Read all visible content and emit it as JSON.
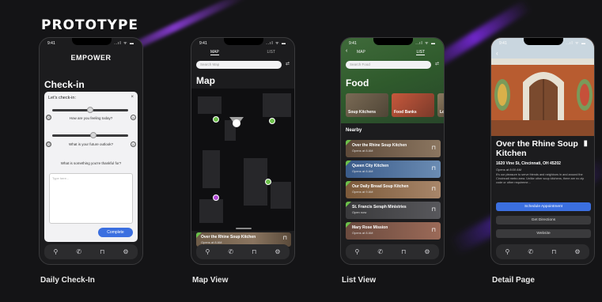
{
  "title": "PROTOTYPE",
  "labels": {
    "checkin": "Daily Check-In",
    "map": "Map View",
    "list": "List View",
    "detail": "Detail Page"
  },
  "status": {
    "time": "9:41",
    "signal": "..ıl ᯤ ▬"
  },
  "tabbar_icons": [
    "search-icon",
    "phone-icon",
    "bookmark-icon",
    "gear-icon"
  ],
  "checkin": {
    "brand": "EMPOWER",
    "heading": "Check-in",
    "card_title": "Let's check-in:",
    "close": "×",
    "q1": "How are you feeling today?",
    "q2": "What is your future outlook?",
    "q3": "What is something you're thankful for?",
    "textarea_placeholder": "Type here...",
    "complete": "Complete"
  },
  "map": {
    "tab_map": "MAP",
    "tab_list": "LIST",
    "search_placeholder": "Search Map",
    "heading": "Map",
    "card_title": "Over the Rhine Soup Kitchen",
    "card_sub": "Opens at 8 AM"
  },
  "list": {
    "tab_map": "MAP",
    "tab_list": "LIST",
    "search_placeholder": "Search Food",
    "heading": "Food",
    "categories": [
      "Soup Kitchens",
      "Food Banks",
      "Lo"
    ],
    "nearby": "Nearby",
    "items": [
      {
        "title": "Over the Rhine Soup Kitchen",
        "sub": "Opens at 8 AM"
      },
      {
        "title": "Queen City Kitchen",
        "sub": "Opens at 8 AM"
      },
      {
        "title": "Our Daily Bread Soup Kitchen",
        "sub": "Opens at 9 AM"
      },
      {
        "title": "St. Francis Seraph Ministries",
        "sub": "Open now"
      },
      {
        "title": "Mary Rose Mission",
        "sub": "Opens at 8 AM"
      }
    ]
  },
  "detail": {
    "heading": "Over the Rhine Soup Kitchen",
    "address": "1620 Vine St, Cincinnati, OH 45202",
    "hours": "Opens at 8:00 AM",
    "description": "It's our pleasure to serve friends and neighbors in and around the Cincinnati metro area. Unlike other soup kitchens, there are no zip code or other requireme...",
    "btn_schedule": "Schedule Appointment",
    "btn_directions": "Get Directions",
    "btn_website": "Website"
  },
  "colors": {
    "accent_blue": "#3b6fe0",
    "pin_green": "#6cc04a",
    "pin_purple": "#b24ad6"
  }
}
